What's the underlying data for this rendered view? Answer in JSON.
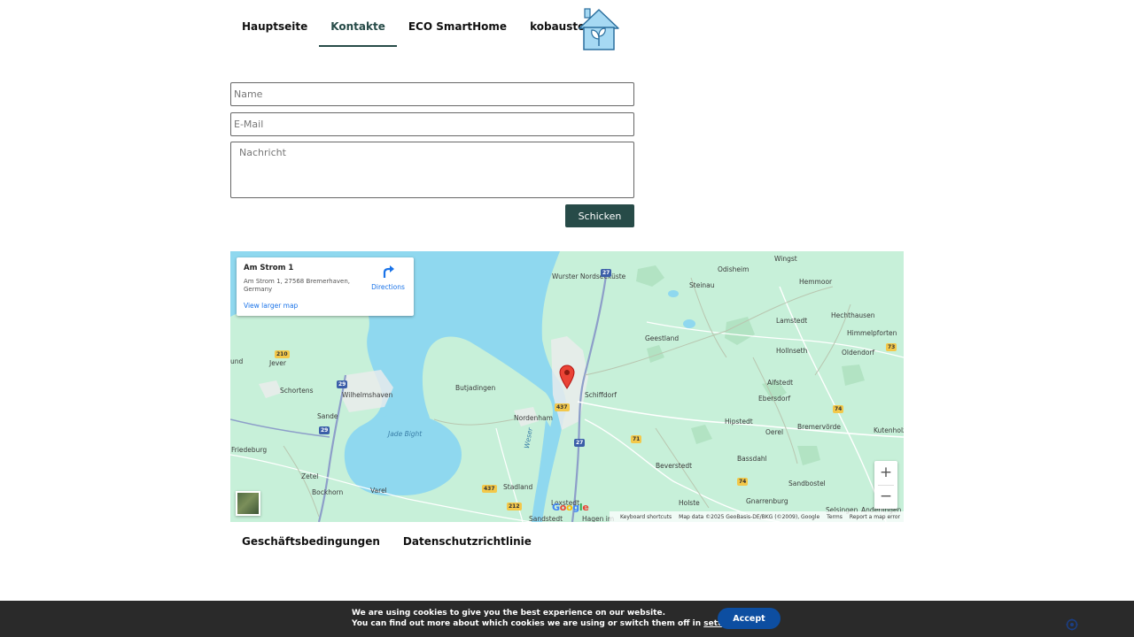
{
  "nav": {
    "items": [
      {
        "label": "Hauptseite"
      },
      {
        "label": "Kontakte"
      },
      {
        "label": "ECO SmartHome"
      },
      {
        "label": "kobaustoffe"
      }
    ]
  },
  "form": {
    "name_placeholder": "Name",
    "email_placeholder": "E-Mail",
    "message_placeholder": "Nachricht",
    "send_label": "Schicken"
  },
  "map": {
    "info": {
      "title": "Am Strom 1",
      "address": "Am Strom 1, 27568 Bremerhaven, Germany",
      "directions_label": "Directions",
      "larger_map_label": "View larger map"
    },
    "places": [
      "Wurster Nordseeküste",
      "Odisheim",
      "Wingst",
      "Steinau",
      "Hemmoor",
      "Hechthausen",
      "Lamstedt",
      "Himmelpforten",
      "Geestland",
      "Hollnseth",
      "Oldendorf",
      "Jever",
      "Schortens",
      "Wilhelmshaven",
      "Butjadingen",
      "Schiffdorf",
      "Alfstedt",
      "Ebersdorf",
      "Sande",
      "Nordenham",
      "Hipstedt",
      "Oerel",
      "Bremervörde",
      "Kutenholz",
      "Friedeburg",
      "Bassdahl",
      "Beverstedt",
      "Zetel",
      "Bockhorn",
      "Varel",
      "Stadland",
      "Holste",
      "Gnarrenburg",
      "Sandbostel",
      "Selsingen",
      "Anderlingen",
      "Loxstedt",
      "Sandstedt",
      "Hagen im",
      "und"
    ],
    "water_labels": [
      "Jade Bight",
      "Weser"
    ],
    "road_shields": [
      "27",
      "210",
      "29",
      "29",
      "437",
      "437",
      "27",
      "71",
      "73",
      "74",
      "74",
      "212"
    ],
    "zoom_in_label": "+",
    "zoom_out_label": "−",
    "google_logo": "Google",
    "attribution": {
      "shortcuts": "Keyboard shortcuts",
      "data": "Map data ©2025 GeoBasis-DE/BKG (©2009), Google",
      "terms": "Terms",
      "report": "Report a map error"
    },
    "colors": {
      "land": "#c7f0d9",
      "water": "#8fd8ef",
      "pin": "#ea4335"
    }
  },
  "footer": {
    "links": [
      {
        "label": "Geschäftsbedingungen"
      },
      {
        "label": "Datenschutzrichtlinie"
      }
    ]
  },
  "cookie": {
    "line1": "We are using cookies to give you the best experience on our website.",
    "line2_prefix": "You can find out more about which cookies we are using or switch them off in ",
    "settings_link": "settings",
    "line2_suffix": ".",
    "accept_label": "Accept"
  },
  "colors": {
    "accent": "#274b48",
    "cookie_bg": "#2a2a2a",
    "accept": "#0d4ea1"
  },
  "icons": [
    "eco-house-logo-icon",
    "directions-icon",
    "map-pin-icon",
    "map-layer-icon",
    "cookie-settings-icon"
  ]
}
